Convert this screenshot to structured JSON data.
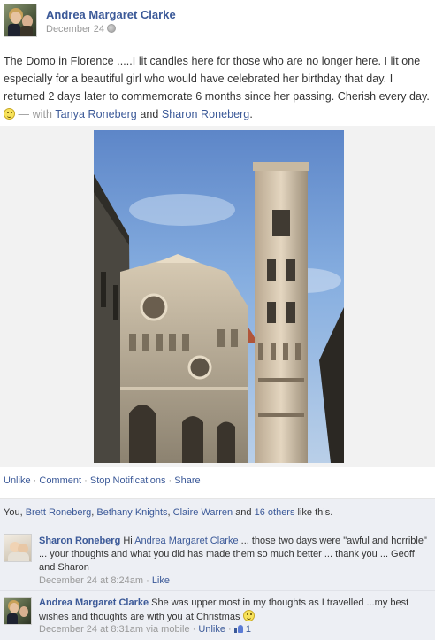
{
  "post": {
    "author": "Andrea Margaret Clarke",
    "date": "December 24",
    "text_main": "The Domo in Florence .....I lit candles here for those who are no longer here. I lit one especially for a beautiful girl who would have celebrated her birthday that day. I returned 2 days later to commemorate 6 months since her passing. Cherish every day.",
    "with_label": "— with",
    "tag_1": "Tanya Roneberg",
    "and_word": "and",
    "tag_2": "Sharon Roneberg",
    "end_period": "."
  },
  "actions": {
    "unlike": "Unlike",
    "comment": "Comment",
    "stop_notifications": "Stop Notifications",
    "share": "Share",
    "separator": "·"
  },
  "likes": {
    "you": "You,",
    "name_1": "Brett Roneberg",
    "name_2": "Bethany Knights",
    "name_3": "Claire Warren",
    "and_word": "and",
    "others": "16 others",
    "suffix": "like this."
  },
  "comments": [
    {
      "author": "Sharon Roneberg",
      "prefix": "Hi",
      "mention": "Andrea Margaret Clarke",
      "text": "... those two days were \"awful and horrible\" ... your thoughts and what you did has made them so much better ... thank you ... Geoff and Sharon",
      "time": "December 24 at 8:24am",
      "like_label": "Like"
    },
    {
      "author": "Andrea Margaret Clarke",
      "text": "She was upper most in my thoughts as I travelled ...my best wishes and thoughts are with you at Christmas",
      "time": "December 24 at 8:31am via mobile",
      "unlike_label": "Unlike",
      "like_count": "1"
    }
  ]
}
